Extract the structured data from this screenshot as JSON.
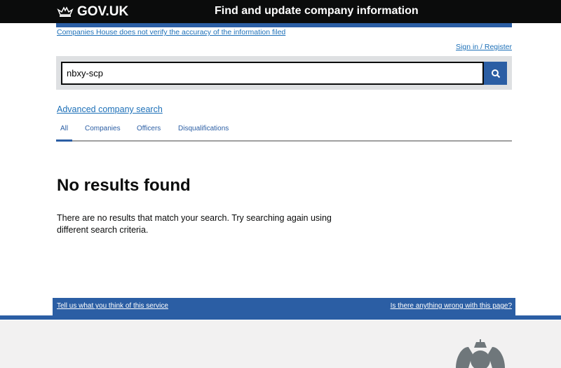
{
  "header": {
    "logo": "GOV.UK",
    "service_name": "Find and update company information"
  },
  "disclaimer": "Companies House does not verify the accuracy of the information filed",
  "sign_in": "Sign in / Register",
  "search": {
    "value": "nbxy-scp",
    "button_icon": "search-icon"
  },
  "advanced_search": "Advanced company search",
  "tabs": [
    {
      "label": "All",
      "active": true
    },
    {
      "label": "Companies"
    },
    {
      "label": "Officers"
    },
    {
      "label": "Disqualifications"
    }
  ],
  "main": {
    "heading": "No results found",
    "message": "There are no results that match your search. Try searching again using different search criteria."
  },
  "feedback": {
    "left": "Tell us what you think of this service",
    "right": "Is there anything wrong with this page?"
  },
  "colors": {
    "header": "#0b0c0c",
    "accent": "#2b5ea4",
    "footer": "#f2f1f1"
  }
}
